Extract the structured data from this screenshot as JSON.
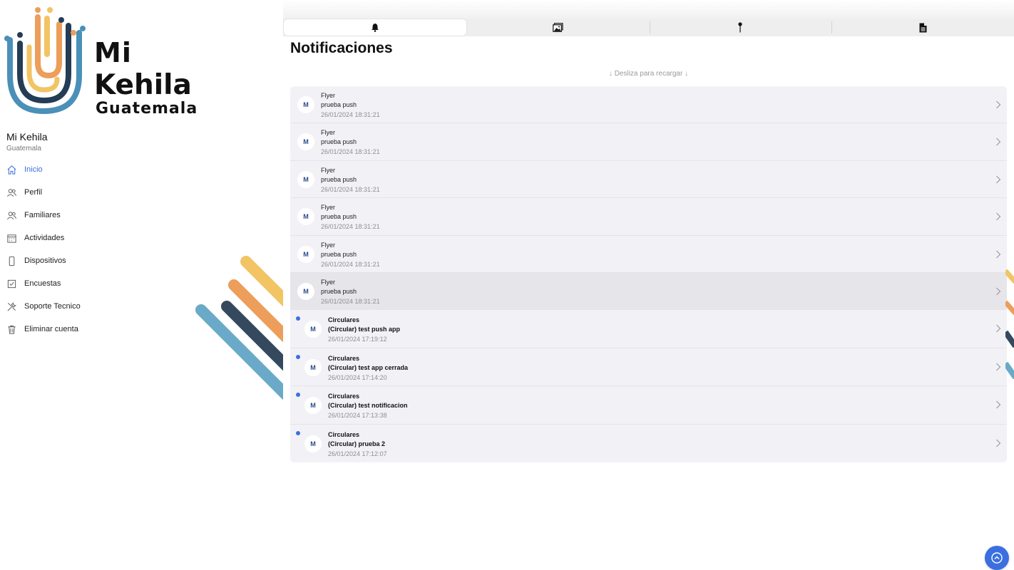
{
  "brand": {
    "logo_mi": "Mi",
    "logo_kehila": "Kehila",
    "logo_guatemala": "Guatemala"
  },
  "org": {
    "name": "Mi Kehila",
    "subtitle": "Guatemala"
  },
  "menu": [
    {
      "label": "Inicio",
      "icon": "home-icon",
      "active": true
    },
    {
      "label": "Perfil",
      "icon": "user-icon",
      "active": false
    },
    {
      "label": "Familiares",
      "icon": "users-icon",
      "active": false
    },
    {
      "label": "Actividades",
      "icon": "calendar-icon",
      "active": false
    },
    {
      "label": "Dispositivos",
      "icon": "phone-icon",
      "active": false
    },
    {
      "label": "Encuestas",
      "icon": "checkbox-icon",
      "active": false
    },
    {
      "label": "Soporte Tecnico",
      "icon": "tools-icon",
      "active": false
    },
    {
      "label": "Eliminar cuenta",
      "icon": "trash-icon",
      "active": false
    }
  ],
  "tabs": [
    {
      "icon": "bell-icon",
      "active": true
    },
    {
      "icon": "gallery-icon",
      "active": false
    },
    {
      "icon": "pin-icon",
      "active": false
    },
    {
      "icon": "document-icon",
      "active": false
    }
  ],
  "main": {
    "title": "Notificaciones",
    "pull_hint": "↓ Desliza para recargar ↓"
  },
  "notifications": [
    {
      "category": "Flyer",
      "message": "prueba push",
      "timestamp": "26/01/2024 18:31:21",
      "unread": false
    },
    {
      "category": "Flyer",
      "message": "prueba push",
      "timestamp": "26/01/2024 18:31:21",
      "unread": false
    },
    {
      "category": "Flyer",
      "message": "prueba push",
      "timestamp": "26/01/2024 18:31:21",
      "unread": false
    },
    {
      "category": "Flyer",
      "message": "prueba push",
      "timestamp": "26/01/2024 18:31:21",
      "unread": false
    },
    {
      "category": "Flyer",
      "message": "prueba push",
      "timestamp": "26/01/2024 18:31:21",
      "unread": false
    },
    {
      "category": "Flyer",
      "message": "prueba push",
      "timestamp": "26/01/2024 18:31:21",
      "unread": false
    },
    {
      "category": "Circulares",
      "message": "(Circular) test push app",
      "timestamp": "26/01/2024 17:19:12",
      "unread": true
    },
    {
      "category": "Circulares",
      "message": "(Circular) test app cerrada",
      "timestamp": "26/01/2024 17:14:20",
      "unread": true
    },
    {
      "category": "Circulares",
      "message": "(Circular) test notificacion",
      "timestamp": "26/01/2024 17:13:38",
      "unread": true
    },
    {
      "category": "Circulares",
      "message": "(Circular) prueba 2",
      "timestamp": "26/01/2024 17:12:07",
      "unread": true
    }
  ],
  "colors": {
    "accent": "#3b6fe0",
    "stripe_yellow": "#f2c464",
    "stripe_orange": "#ec9e5a",
    "stripe_navy": "#34495e",
    "stripe_blue": "#6aaac8"
  },
  "fab": {
    "icon": "chevron-up-icon"
  }
}
